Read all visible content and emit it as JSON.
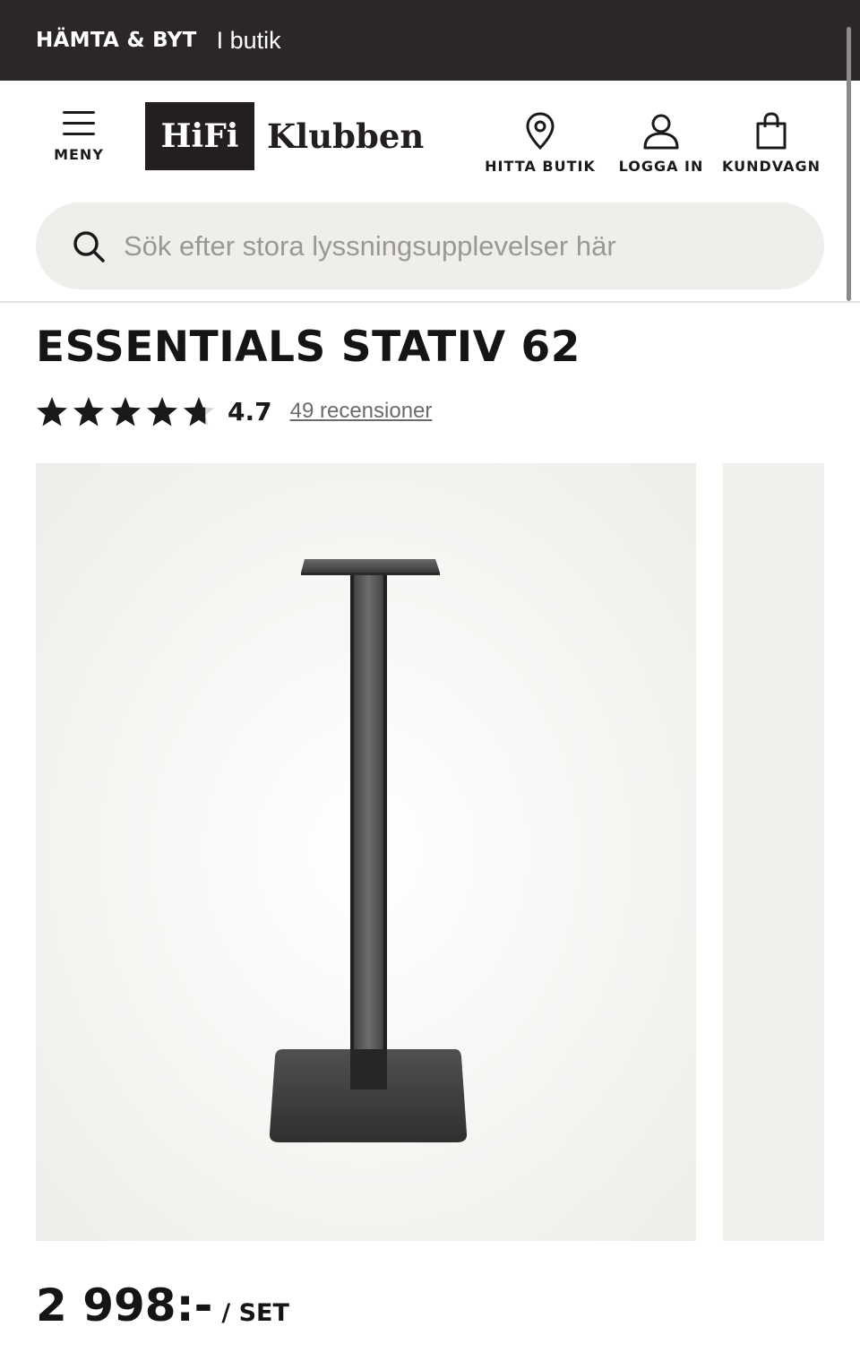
{
  "promo": {
    "bold_text": "HÄMTA & BYT",
    "text": "I butik"
  },
  "header": {
    "menu_label": "MENY",
    "logo_box_text": "HiFi",
    "logo_word": "Klubben",
    "actions": [
      {
        "label": "HITTA BUTIK",
        "icon": "location-pin-icon"
      },
      {
        "label": "LOGGA IN",
        "icon": "user-icon"
      },
      {
        "label": "KUNDVAGN",
        "icon": "shopping-bag-icon"
      }
    ]
  },
  "search": {
    "placeholder": "Sök efter stora lyssningsupplevelser här",
    "value": ""
  },
  "product": {
    "title": "ESSENTIALS STATIV 62",
    "rating": {
      "score": "4.7",
      "stars": 4.7,
      "max_stars": 5,
      "reviews_label": "49 recensioner"
    },
    "price": "2 998:-",
    "unit": "/ SET",
    "image": "speaker-stand-image"
  },
  "colors": {
    "promo_bg": "#2b2727",
    "logo_box": "#231f1f",
    "search_bg": "#efeeea",
    "image_bg": "#efede9",
    "stand_metal": "#3a3a3a"
  }
}
